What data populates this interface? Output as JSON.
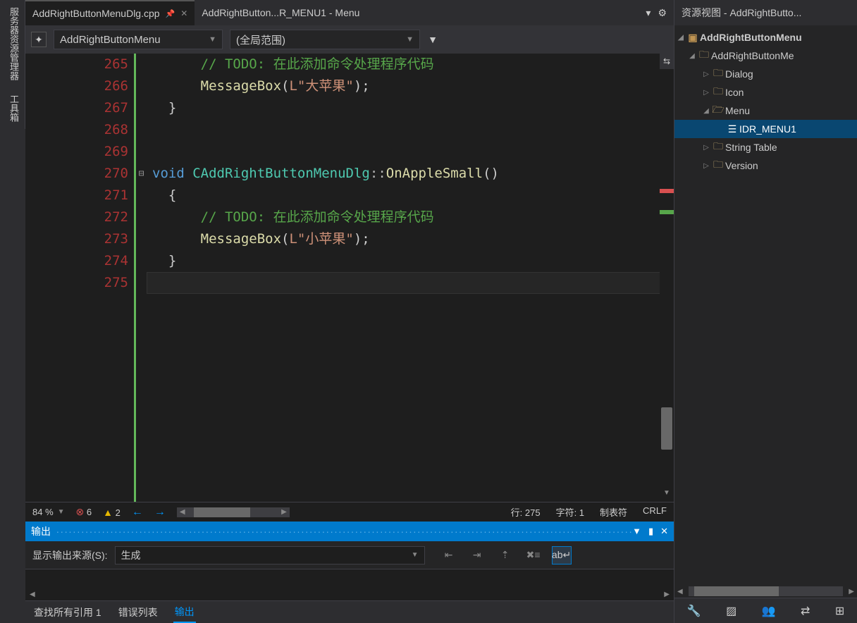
{
  "vtabs": {
    "t1": "服务器资源管理器",
    "t2": "工具箱"
  },
  "tabs": {
    "active_label": "AddRightButtonMenuDlg.cpp",
    "other_label": "AddRightButton...R_MENU1 - Menu"
  },
  "ctx": {
    "class_dd": "AddRightButtonMenu",
    "scope_dd": "(全局范围)"
  },
  "code": {
    "lines": [
      {
        "n": "265",
        "fold": "",
        "t": [
          "      ",
          "// TODO: 在此添加命令处理程序代码"
        ],
        "cls": [
          "",
          "cmt"
        ]
      },
      {
        "n": "266",
        "fold": "",
        "t": [
          "      ",
          "MessageBox",
          "(",
          "L\"大苹果\"",
          ")",
          ";"
        ],
        "cls": [
          "",
          "func",
          "punc",
          "str",
          "punc",
          "punc"
        ]
      },
      {
        "n": "267",
        "fold": "",
        "t": [
          "  }"
        ],
        "cls": [
          "punc"
        ]
      },
      {
        "n": "268",
        "fold": "",
        "t": [
          ""
        ],
        "cls": [
          ""
        ]
      },
      {
        "n": "269",
        "fold": "",
        "t": [
          ""
        ],
        "cls": [
          ""
        ]
      },
      {
        "n": "270",
        "fold": "⊟",
        "t": [
          "void",
          " ",
          "CAddRightButtonMenuDlg",
          "::",
          "OnAppleSmall",
          "()"
        ],
        "cls": [
          "kw",
          "",
          "cls",
          "op",
          "func",
          "punc"
        ]
      },
      {
        "n": "271",
        "fold": "",
        "t": [
          "  {"
        ],
        "cls": [
          "punc"
        ]
      },
      {
        "n": "272",
        "fold": "",
        "t": [
          "      ",
          "// TODO: 在此添加命令处理程序代码"
        ],
        "cls": [
          "",
          "cmt"
        ]
      },
      {
        "n": "273",
        "fold": "",
        "t": [
          "      ",
          "MessageBox",
          "(",
          "L\"小苹果\"",
          ")",
          ";"
        ],
        "cls": [
          "",
          "func",
          "punc",
          "str",
          "punc",
          "punc"
        ]
      },
      {
        "n": "274",
        "fold": "",
        "t": [
          "  }"
        ],
        "cls": [
          "punc"
        ]
      },
      {
        "n": "275",
        "fold": "",
        "t": [
          ""
        ],
        "cls": [
          ""
        ],
        "cur": true
      }
    ]
  },
  "status": {
    "zoom": "84 %",
    "errors": "6",
    "warnings": "2",
    "line": "行: 275",
    "col": "字符: 1",
    "tab": "制表符",
    "crlf": "CRLF"
  },
  "output": {
    "title": "输出",
    "src_label": "显示输出来源(S):",
    "src_value": "生成"
  },
  "bottom_tabs": {
    "t1": "查找所有引用 1",
    "t2": "错误列表",
    "t3": "输出"
  },
  "resview": {
    "title": "资源视图 - AddRightButto...",
    "root": "AddRightButtonMenu",
    "proj": "AddRightButtonMe",
    "n_dialog": "Dialog",
    "n_icon": "Icon",
    "n_menu": "Menu",
    "n_menu_item": "IDR_MENU1",
    "n_string": "String Table",
    "n_version": "Version"
  }
}
